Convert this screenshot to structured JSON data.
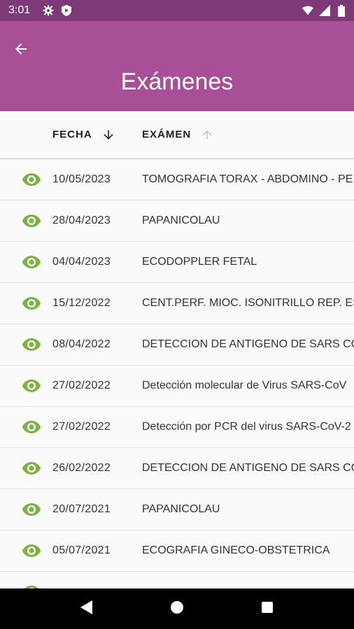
{
  "status_bar": {
    "time": "3:01",
    "left_icons": [
      "gear-icon",
      "shield-play-icon"
    ],
    "right_icons": [
      "wifi-icon",
      "signal-icon",
      "battery-icon"
    ]
  },
  "app_bar": {
    "title": "Exámenes",
    "background": "#a84f98",
    "status_background": "#7e3a78"
  },
  "table": {
    "columns": [
      {
        "label": "FECHA",
        "sort": "descending-active"
      },
      {
        "label": "EXÁMEN",
        "sort": "ascending-inactive"
      }
    ],
    "accent_color": "#7cb342",
    "rows": [
      {
        "date": "10/05/2023",
        "exam": "TOMOGRAFIA TORAX - ABDOMINO - PE"
      },
      {
        "date": "28/04/2023",
        "exam": "PAPANICOLAU"
      },
      {
        "date": "04/04/2023",
        "exam": "ECODOPPLER FETAL"
      },
      {
        "date": "15/12/2022",
        "exam": "CENT.PERF. MIOC. ISONITRILLO REP.  ES"
      },
      {
        "date": "08/04/2022",
        "exam": "DETECCION DE ANTIGENO DE SARS CO"
      },
      {
        "date": "27/02/2022",
        "exam": "Detección molecular de Virus SARS-CoV"
      },
      {
        "date": "27/02/2022",
        "exam": "Detección por PCR del virus SARS-CoV-2"
      },
      {
        "date": "26/02/2022",
        "exam": "DETECCION DE ANTIGENO DE SARS CO"
      },
      {
        "date": "20/07/2021",
        "exam": "PAPANICOLAU"
      },
      {
        "date": "05/07/2021",
        "exam": "ECOGRAFIA GINECO-OBSTETRICA"
      },
      {
        "date": "",
        "exam": ""
      }
    ]
  },
  "nav_bar": {
    "buttons": [
      "back-triangle-icon",
      "home-circle-icon",
      "recents-square-icon"
    ]
  }
}
